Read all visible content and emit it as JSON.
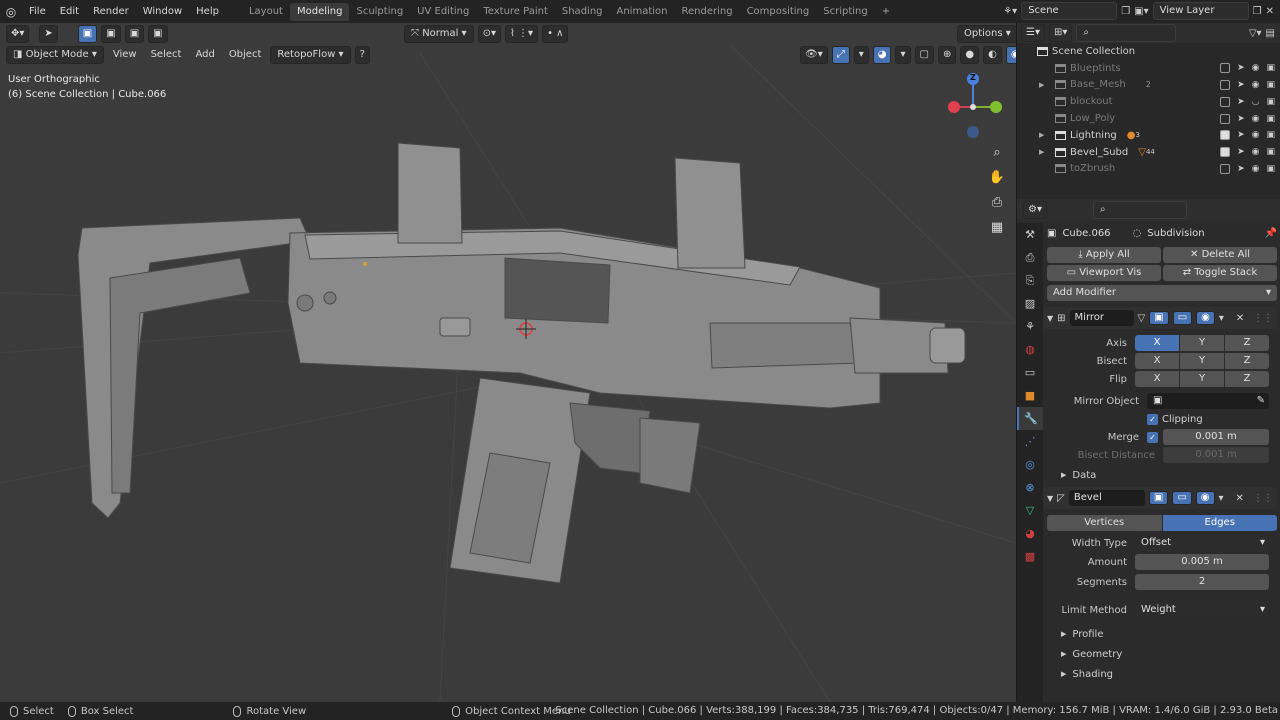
{
  "app": {
    "menu": [
      "File",
      "Edit",
      "Render",
      "Window",
      "Help"
    ]
  },
  "workspaces": {
    "tabs": [
      "Layout",
      "Modeling",
      "Sculpting",
      "UV Editing",
      "Texture Paint",
      "Shading",
      "Animation",
      "Rendering",
      "Compositing",
      "Scripting"
    ],
    "active": "Modeling"
  },
  "topbar": {
    "scene": "Scene",
    "view_layer": "View Layer"
  },
  "viewport": {
    "mode": "Object Mode",
    "menus": [
      "View",
      "Select",
      "Add",
      "Object",
      "RetopoFlow"
    ],
    "orientation": "Normal",
    "options": "Options",
    "view_name": "User Orthographic",
    "context": "(6) Scene Collection | Cube.066",
    "gizmo": {
      "z": "Z"
    }
  },
  "outliner": {
    "root": "Scene Collection",
    "items": [
      {
        "name": "Blueptints",
        "dim": true,
        "badge": ""
      },
      {
        "name": "Base_Mesh",
        "dim": true,
        "badge": "2"
      },
      {
        "name": "blockout",
        "dim": true,
        "badge": ""
      },
      {
        "name": "Low_Poly",
        "dim": true,
        "badge": ""
      },
      {
        "name": "Lightning",
        "dim": false,
        "badge": "3"
      },
      {
        "name": "Bevel_Subd",
        "dim": false,
        "badge": "44"
      },
      {
        "name": "toZbrush",
        "dim": true,
        "badge": ""
      }
    ]
  },
  "properties": {
    "object": "Cube.066",
    "modifier_label": "Subdivision",
    "apply_all": "Apply All",
    "delete_all": "Delete All",
    "viewport_vis": "Viewport Vis",
    "toggle_stack": "Toggle Stack",
    "add_modifier": "Add Modifier",
    "mirror": {
      "name": "Mirror",
      "axis_label": "Axis",
      "bisect_label": "Bisect",
      "flip_label": "Flip",
      "x": "X",
      "y": "Y",
      "z": "Z",
      "mirror_object_label": "Mirror Object",
      "clipping": "Clipping",
      "merge_label": "Merge",
      "merge_value": "0.001 m",
      "bisect_distance_label": "Bisect Distance",
      "bisect_distance_value": "0.001 m",
      "data": "Data"
    },
    "bevel": {
      "name": "Bevel",
      "vertices": "Vertices",
      "edges": "Edges",
      "width_type_label": "Width Type",
      "width_type_value": "Offset",
      "amount_label": "Amount",
      "amount_value": "0.005 m",
      "segments_label": "Segments",
      "segments_value": "2",
      "limit_method_label": "Limit Method",
      "limit_method_value": "Weight",
      "profile": "Profile",
      "geometry": "Geometry",
      "shading": "Shading"
    }
  },
  "statusbar": {
    "select": "Select",
    "box_select": "Box Select",
    "rotate_view": "Rotate View",
    "context_menu": "Object Context Menu",
    "stats": "Scene Collection | Cube.066 | Verts:388,199 | Faces:384,735 | Tris:769,474 | Objects:0/47 | Memory: 156.7 MiB | VRAM: 1.4/6.0 GiB | 2.93.0 Beta"
  }
}
